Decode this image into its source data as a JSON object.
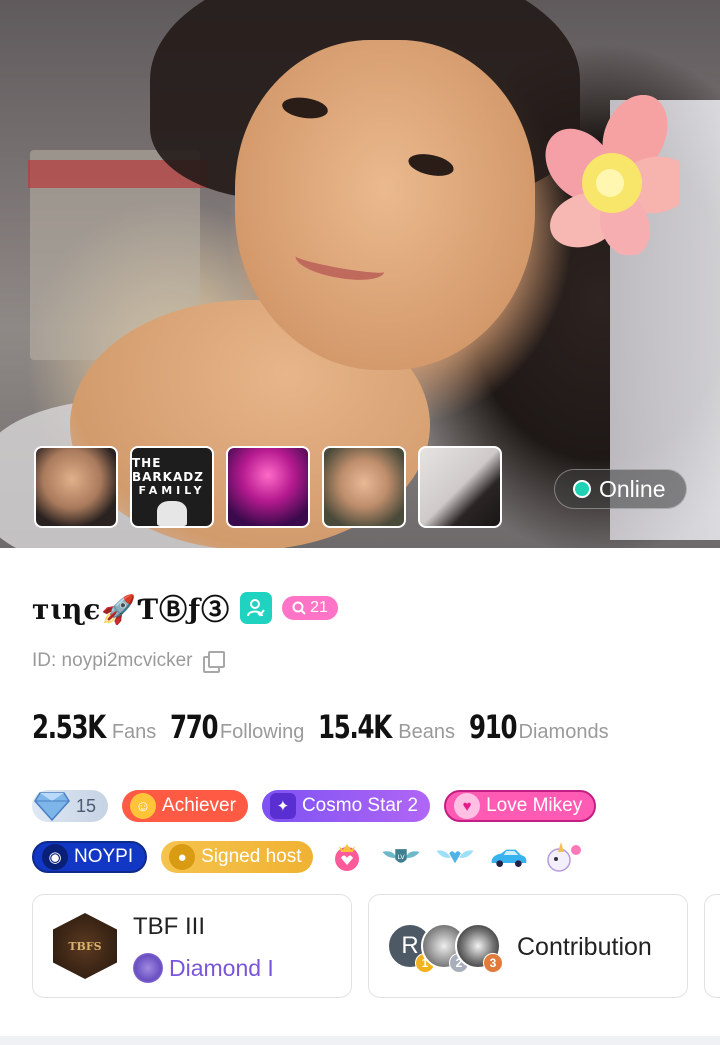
{
  "header": {
    "status_label": "Online",
    "status_color": "#1fd2b4",
    "thumbnails": [
      {
        "name": "photo-1"
      },
      {
        "name": "photo-2",
        "line1": "THE BARKADZ",
        "line2": "FAMILY"
      },
      {
        "name": "photo-3"
      },
      {
        "name": "photo-4"
      },
      {
        "name": "photo-5"
      }
    ]
  },
  "profile": {
    "name": "ᴛɩɳє🚀ƬⒷƒ③",
    "verified_icon": "person-check-icon",
    "level_icon": "crown-icon",
    "level": "21",
    "id_text": "ID: noypi2mcvicker"
  },
  "stats": [
    {
      "value": "2.53K",
      "label": "Fans"
    },
    {
      "value": "770",
      "label": "Following"
    },
    {
      "value": "15.4K",
      "label": "Beans"
    },
    {
      "value": "910",
      "label": "Diamonds"
    }
  ],
  "badges": {
    "diamond_level": "15",
    "achiever": "Achiever",
    "cosmo_star": "Cosmo Star 2",
    "love": "Love Mikey",
    "noypi": "NOYPI",
    "signed_host": "Signed host"
  },
  "family_card": {
    "logo_text": "TBFS",
    "name": "TBF III",
    "rank": "Diamond I"
  },
  "contribution_card": {
    "label": "Contribution",
    "avatars": [
      {
        "initial": "R",
        "rank": "1"
      },
      {
        "initial": "",
        "rank": "2"
      },
      {
        "initial": "",
        "rank": "3"
      }
    ]
  }
}
